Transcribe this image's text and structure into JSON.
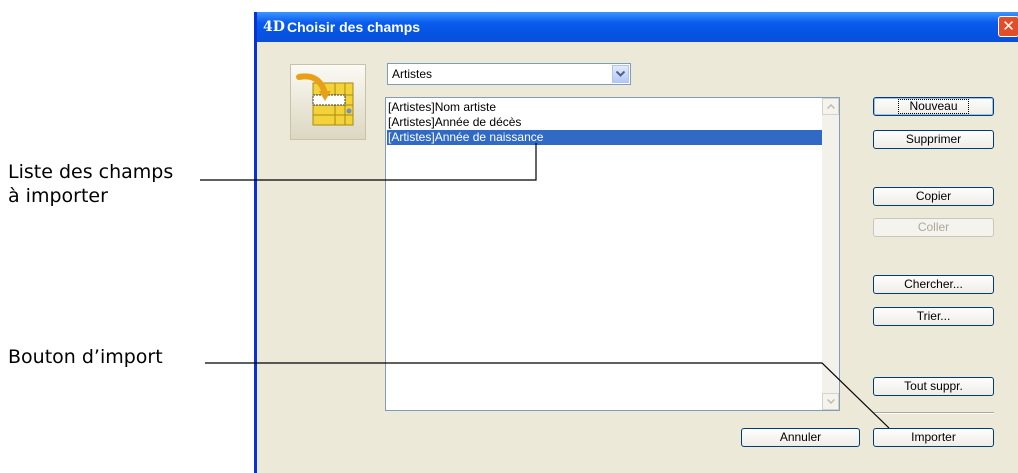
{
  "callouts": {
    "fields_list": [
      "Liste des champs",
      "à importer"
    ],
    "import_button": "Bouton d’import"
  },
  "window": {
    "logo": "4D",
    "title": "Choisir des champs",
    "close_glyph": "✕"
  },
  "table_select": {
    "value": "Artistes"
  },
  "field_list": [
    {
      "table": "[Artistes]",
      "field": "Nom artiste",
      "selected": false
    },
    {
      "table": "[Artistes]",
      "field": "Année de décès",
      "selected": false
    },
    {
      "table": "[Artistes]",
      "field": "Année de naissance",
      "selected": true
    }
  ],
  "buttons": {
    "new": "Nouveau",
    "delete": "Supprimer",
    "copy": "Copier",
    "paste": "Coller",
    "find": "Chercher...",
    "sort": "Trier...",
    "clear_all": "Tout suppr.",
    "cancel": "Annuler",
    "import": "Importer"
  },
  "colors": {
    "titlebar": "#0a5cee",
    "selection": "#316ac5",
    "dialog_bg": "#ece9d8",
    "close": "#e04f2a"
  }
}
